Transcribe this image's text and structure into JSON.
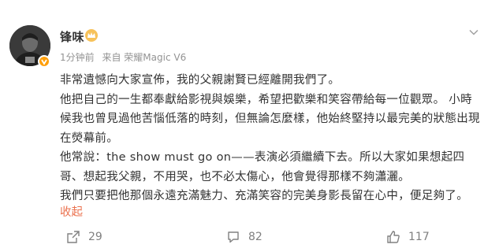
{
  "post": {
    "author": {
      "name": "锋味",
      "avatar_icon": "avatar-photo",
      "verified_icon": "orange-v-badge",
      "member_icon": "gold-member-badge"
    },
    "meta": {
      "time": "1分钟前",
      "source": "来自 荣耀Magic V6"
    },
    "paragraphs": [
      "非常遺憾向大家宣佈，我的父親謝賢已經離開我們了。",
      "他把自己的一生都奉獻給影視與娛樂，希望把歡樂和笑容帶給每一位觀眾。 小時候我也曾見過他苦惱低落的時刻，但無論怎麼樣，他始終堅持以最完美的狀態出現在熒幕前。",
      "他常說：the show must go on——表演必須繼續下去。所以大家如果想起四哥、想起我父親，不用哭，也不必太傷心，他會覺得那樣不夠瀟灑。",
      "我們只要把他那個永遠充滿魅力、充滿笑容的完美身影長留在心中，便足夠了。"
    ],
    "collapse_label": "收起",
    "actions": {
      "share_count": "29",
      "comment_count": "82",
      "like_count": "117"
    },
    "colors": {
      "link": "#eb7350",
      "meta": "#939393",
      "action": "#808080",
      "text": "#333333"
    }
  }
}
